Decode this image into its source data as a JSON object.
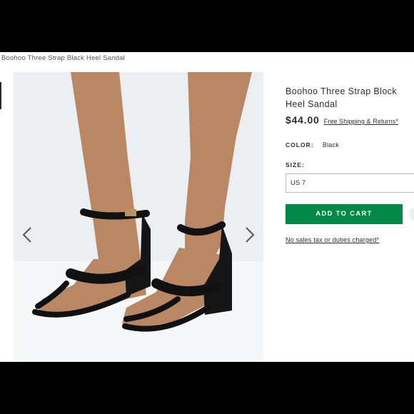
{
  "breadcrumb": "Boohoo Three Strap Black Heel Sandal",
  "product": {
    "title": "Boohoo Three Strap Block Heel Sandal",
    "price": "$44.00",
    "shipping_link": "Free Shipping & Returns*",
    "color_label": "COLOR:",
    "color_value": "Black",
    "size_label": "SIZE:",
    "size_value": "US 7",
    "add_to_cart": "ADD TO CART",
    "tax_note": "No sales tax or duties charged*"
  },
  "colors": {
    "add_to_cart_bg": "#018849",
    "text": "#2d2d2d",
    "gallery_bg": "#eceff1"
  },
  "icons": {
    "prev": "chevron-left-icon",
    "next": "chevron-right-icon"
  }
}
